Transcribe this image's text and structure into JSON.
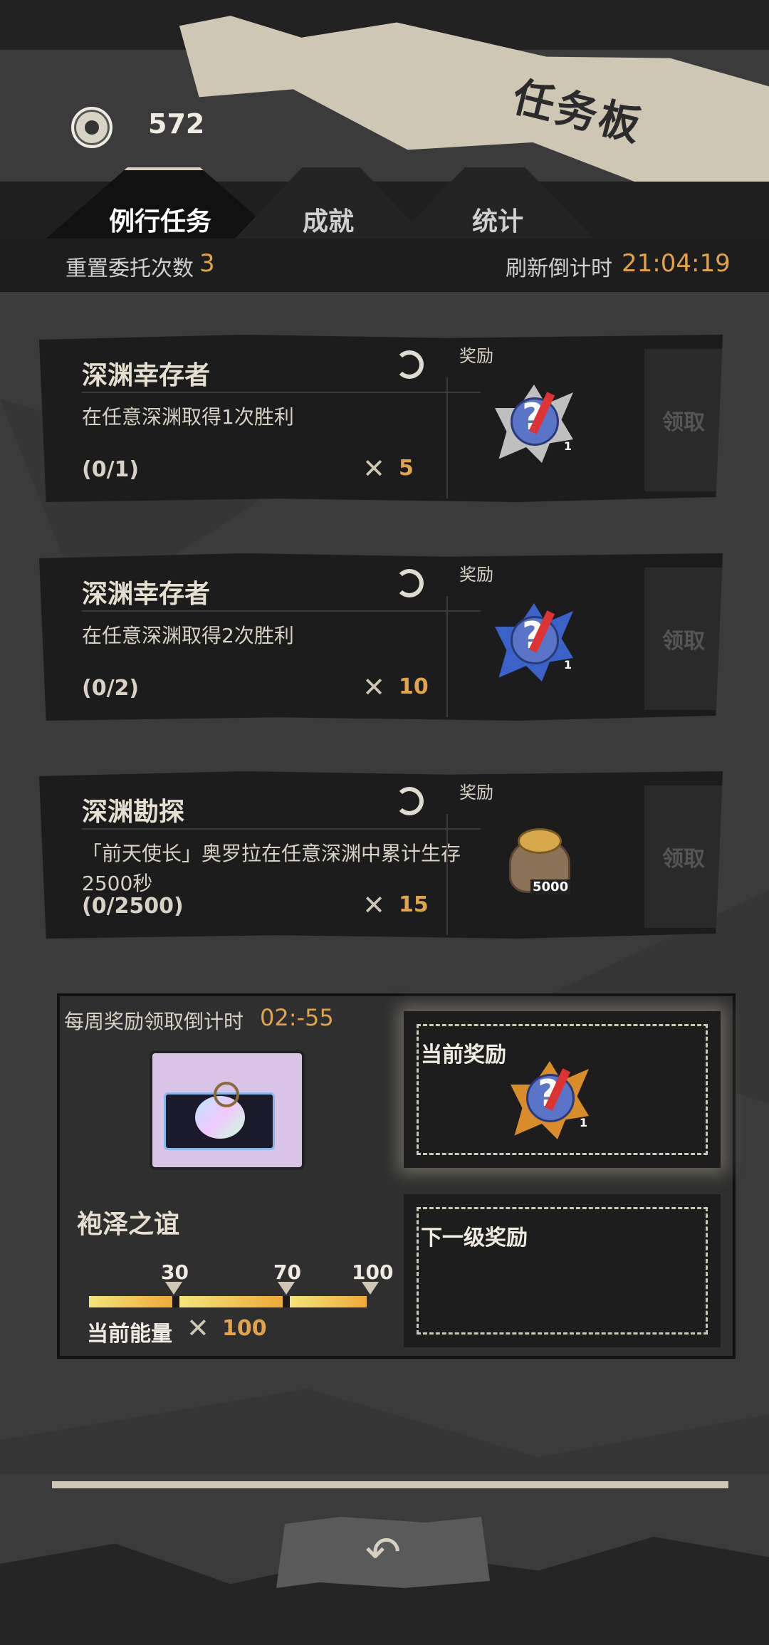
{
  "header": {
    "title": "任务板",
    "coin_icon": "coin-icon",
    "coin_count": "572"
  },
  "tabs": [
    {
      "label": "例行任务",
      "active": true
    },
    {
      "label": "成就",
      "active": false
    },
    {
      "label": "统计",
      "active": false
    }
  ],
  "stats": {
    "reset_label": "重置委托次数",
    "reset_value": "3",
    "refresh_label": "刷新倒计时",
    "refresh_value": "21:04:19"
  },
  "tasks": [
    {
      "title": "深渊幸存者",
      "description": "在任意深渊取得1次胜利",
      "progress": "(0/1)",
      "points": "5",
      "reward_label": "奖励",
      "reward_icon": "mystery-item-icon",
      "reward_count": "1",
      "claim_label": "领取"
    },
    {
      "title": "深渊幸存者",
      "description": "在任意深渊取得2次胜利",
      "progress": "(0/2)",
      "points": "10",
      "reward_label": "奖励",
      "reward_icon": "mystery-item-icon",
      "reward_count": "1",
      "claim_label": "领取"
    },
    {
      "title": "深渊勘探",
      "description": "「前天使长」奥罗拉在任意深渊中累计生存2500秒",
      "progress": "(0/2500)",
      "points": "15",
      "reward_label": "奖励",
      "reward_icon": "gold-bag-icon",
      "reward_count": "5000",
      "claim_label": "领取"
    }
  ],
  "weekly": {
    "timer_label": "每周奖励领取倒计时",
    "timer_value": "02:-55",
    "chest_name": "袍泽之谊",
    "ticks": [
      "30",
      "70",
      "100"
    ],
    "energy_label": "当前能量",
    "energy_value": "100",
    "energy_fraction": 1.0,
    "current_reward_label": "当前奖励",
    "current_reward_count": "1",
    "next_reward_label": "下一级奖励"
  },
  "colors": {
    "accent": "#e2a44a",
    "paper": "#cfc6b3",
    "background": "#3b3b3b"
  }
}
